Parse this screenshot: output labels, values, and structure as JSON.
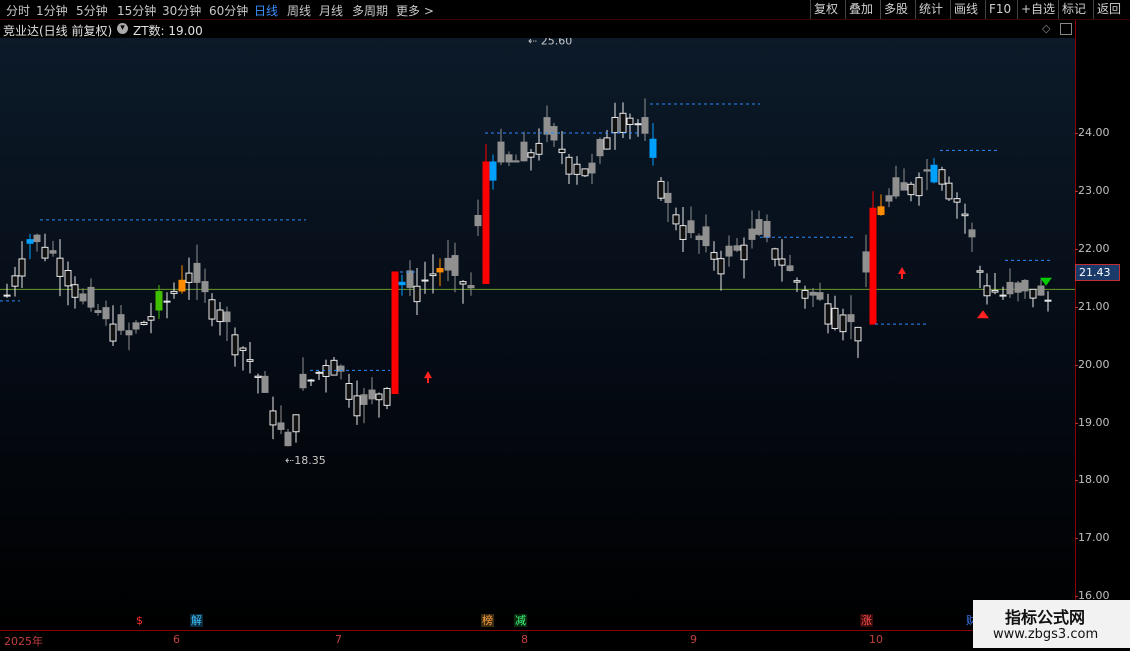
{
  "toolbar": {
    "timeframes": [
      "分时",
      "1分钟",
      "5分钟",
      "15分钟",
      "30分钟",
      "60分钟",
      "日线",
      "周线",
      "月线",
      "多周期",
      "更多"
    ],
    "active_timeframe": "日线",
    "tools": [
      "复权",
      "叠加",
      "多股",
      "统计",
      "画线",
      "F10",
      "+自选",
      "标记",
      "返回"
    ]
  },
  "info": {
    "stock_title": "竞业达(日线 前复权)",
    "indicator": "ZT数: 19.00"
  },
  "price_axis": {
    "labels": [
      "24.00",
      "23.00",
      "22.00",
      "21.00",
      "20.00",
      "19.00",
      "18.00",
      "17.00",
      "16.00"
    ],
    "current_price": "21.43",
    "high_label": "25.60",
    "low_label": "18.35"
  },
  "time_axis": {
    "labels": [
      "2025年",
      "6",
      "7",
      "8",
      "9",
      "10"
    ],
    "markers": [
      {
        "text": "$",
        "color": "#ff3030"
      },
      {
        "text": "解",
        "color": "#40c0ff"
      },
      {
        "text": "榜",
        "color": "#ffa040"
      },
      {
        "text": "减",
        "color": "#40ff80"
      },
      {
        "text": "涨",
        "color": "#ff5050"
      },
      {
        "text": "财",
        "color": "#4080ff"
      }
    ]
  },
  "watermark": {
    "title": "指标公式网",
    "url": "www.zbgs3.com"
  },
  "colors": {
    "up_red": "#ff0000",
    "down_gray": "#909090",
    "highlight_blue": "#00a0ff",
    "highlight_orange": "#ff8c00",
    "green_arrow": "#00cc00",
    "current_line": "#6a9a2a"
  },
  "chart_data": {
    "type": "candlestick",
    "yticks": [
      24,
      23,
      22,
      21,
      20,
      19,
      18,
      17,
      16
    ],
    "current": 21.43,
    "high": 25.6,
    "low": 18.35,
    "last_close": 21.2
  }
}
